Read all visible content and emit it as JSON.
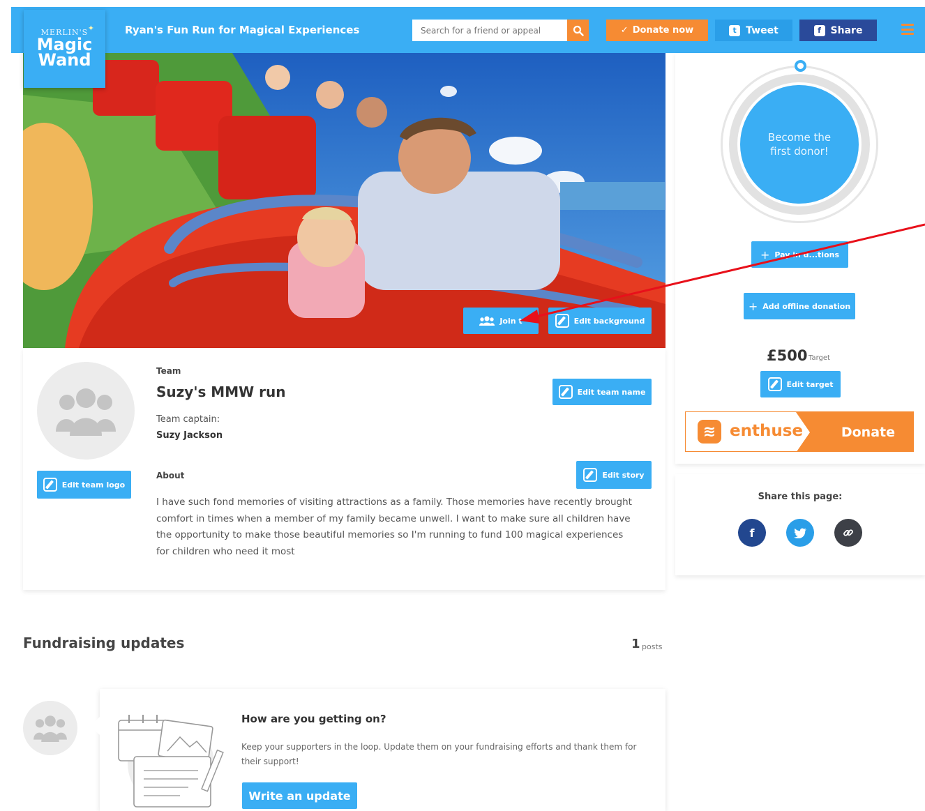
{
  "header": {
    "logo_line1": "MERLIN'S",
    "logo_line2": "Magic",
    "logo_line3": "Wand",
    "title": "Ryan's Fun Run for Magical Experiences",
    "search_placeholder": "Search for a friend or appeal",
    "donate_now": "Donate now",
    "tweet": "Tweet",
    "share": "Share"
  },
  "hero": {
    "join_team": "Join t",
    "edit_background": "Edit background"
  },
  "team": {
    "section_label": "Team",
    "name": "Suzy's MMW run",
    "edit_team_name": "Edit team name",
    "captain_label": "Team captain:",
    "captain_name": "Suzy Jackson",
    "edit_team_logo": "Edit team logo",
    "about_label": "About",
    "edit_story": "Edit story",
    "about_text": "I have such fond memories of visiting attractions as a family. Those memories have recently brought comfort in times when a member of my family became unwell. I want to make sure all children have the opportunity to make those beautiful memories so I'm running to fund 100 magical experiences for children who need it most"
  },
  "sidebar": {
    "donor_prompt": "Become the first donor!",
    "pay_in_donations": "Pay in d...tions",
    "add_offline_donation": "Add offline donation",
    "target_amount": "£500",
    "target_label": "Target",
    "edit_target": "Edit target",
    "enthuse_brand": "enthuse",
    "enthuse_donate": "Donate",
    "share_title": "Share this page:"
  },
  "updates": {
    "title": "Fundraising updates",
    "post_count": "1",
    "posts_label": "posts",
    "question": "How are you getting on?",
    "description": "Keep your supporters in the loop. Update them on your fundraising efforts and thank them for their support!",
    "write_button": "Write an update"
  },
  "colors": {
    "brand_blue": "#3aaef4",
    "accent_orange": "#f68b33",
    "facebook_navy": "#2a4a9a",
    "annotation_red": "#e8101a"
  },
  "icons": [
    "search-icon",
    "check-icon",
    "twitter-icon",
    "facebook-icon",
    "menu-icon",
    "group-icon",
    "edit-icon",
    "plus-icon",
    "link-icon"
  ]
}
